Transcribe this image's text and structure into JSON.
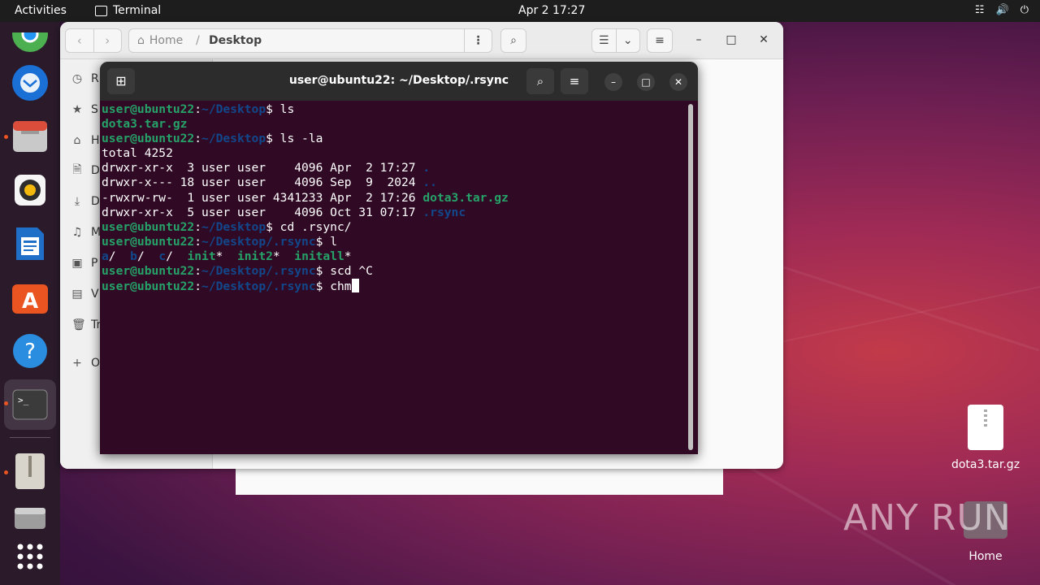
{
  "topbar": {
    "activities": "Activities",
    "app_name": "Terminal",
    "clock": "Apr 2  17:27"
  },
  "dock": {
    "items": [
      "chrome-icon",
      "thunderbird-icon",
      "files-icon",
      "rhythmbox-icon",
      "writer-icon",
      "app-center-icon",
      "help-icon",
      "terminal-icon",
      "archive-icon",
      "drive-icon",
      "app-grid-icon"
    ]
  },
  "files": {
    "path_home": "Home",
    "path_sep": "/",
    "path_current": "Desktop",
    "sidebar": [
      {
        "icon": "clock-icon",
        "label": "R"
      },
      {
        "icon": "star-icon",
        "label": "S"
      },
      {
        "icon": "home-icon",
        "label": "H"
      },
      {
        "icon": "document-icon",
        "label": "D"
      },
      {
        "icon": "download-icon",
        "label": "D"
      },
      {
        "icon": "music-icon",
        "label": "M"
      },
      {
        "icon": "picture-icon",
        "label": "P"
      },
      {
        "icon": "video-icon",
        "label": "V"
      },
      {
        "icon": "trash-icon",
        "label": "Tr"
      },
      {
        "icon": "plus-icon",
        "label": "O"
      }
    ]
  },
  "terminal": {
    "title": "user@ubuntu22: ~/Desktop/.rsync",
    "lines": [
      {
        "user": "user@ubuntu22",
        "sep": ":",
        "path": "~/Desktop",
        "cmd": "$ ls"
      },
      {
        "out": [
          {
            "t": "dota3.tar.gz",
            "c": "green"
          }
        ]
      },
      {
        "user": "user@ubuntu22",
        "sep": ":",
        "path": "~/Desktop",
        "cmd": "$ ls -la"
      },
      {
        "out": [
          {
            "t": "total 4252",
            "c": ""
          }
        ]
      },
      {
        "out": [
          {
            "t": "drwxr-xr-x  3 user user    4096 Apr  2 17:27 ",
            "c": ""
          },
          {
            "t": ".",
            "c": "blue"
          }
        ]
      },
      {
        "out": [
          {
            "t": "drwxr-x--- 18 user user    4096 Sep  9  2024 ",
            "c": ""
          },
          {
            "t": "..",
            "c": "blue"
          }
        ]
      },
      {
        "out": [
          {
            "t": "-rwxrw-rw-  1 user user 4341233 Apr  2 17:26 ",
            "c": ""
          },
          {
            "t": "dota3.tar.gz",
            "c": "green"
          }
        ]
      },
      {
        "out": [
          {
            "t": "drwxr-xr-x  5 user user    4096 Oct 31 07:17 ",
            "c": ""
          },
          {
            "t": ".rsync",
            "c": "blue"
          }
        ]
      },
      {
        "user": "user@ubuntu22",
        "sep": ":",
        "path": "~/Desktop",
        "cmd": "$ cd .rsync/"
      },
      {
        "user": "user@ubuntu22",
        "sep": ":",
        "path": "~/Desktop/.rsync",
        "cmd": "$ l"
      },
      {
        "out": [
          {
            "t": "a",
            "c": "blue"
          },
          {
            "t": "/  ",
            "c": ""
          },
          {
            "t": "b",
            "c": "blue"
          },
          {
            "t": "/  ",
            "c": ""
          },
          {
            "t": "c",
            "c": "blue"
          },
          {
            "t": "/  ",
            "c": ""
          },
          {
            "t": "init",
            "c": "green"
          },
          {
            "t": "*  ",
            "c": ""
          },
          {
            "t": "init2",
            "c": "green"
          },
          {
            "t": "*  ",
            "c": ""
          },
          {
            "t": "initall",
            "c": "green"
          },
          {
            "t": "*",
            "c": ""
          }
        ]
      },
      {
        "user": "user@ubuntu22",
        "sep": ":",
        "path": "~/Desktop/.rsync",
        "cmd": "$ scd ^C"
      },
      {
        "user": "user@ubuntu22",
        "sep": ":",
        "path": "~/Desktop/.rsync",
        "cmd": "$ chm",
        "cursor": true
      }
    ]
  },
  "desktop": {
    "file_label": "dota3.tar.gz",
    "home_label": "Home",
    "watermark": "ANY RUN"
  },
  "colors": {
    "terminal_bg": "#300a24",
    "prompt_user": "#26a269",
    "prompt_path": "#12488b",
    "accent": "#e95420"
  }
}
